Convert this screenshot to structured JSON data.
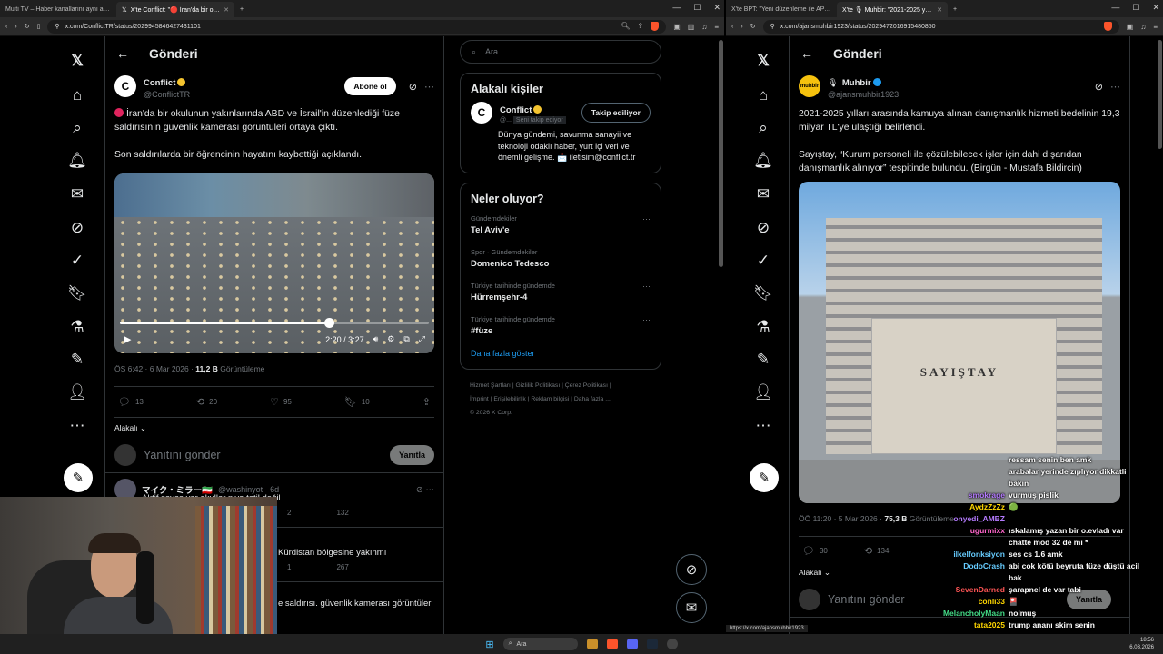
{
  "left_browser": {
    "tabs": [
      {
        "label": "Multi TV – Haber kanallarını aynı an..."
      },
      {
        "label": "X'te Conflict: \"🔴 İran'da bir oku...",
        "active": true
      }
    ],
    "url": "x.com/ConflictTR/status/2029945846427431101"
  },
  "right_browser": {
    "tabs": [
      {
        "label": "X'te BPT: \"Yeni düzenleme ile APP pl..."
      },
      {
        "label": "X'te 🎙 Muhbir: \"2021-2025 yılla...",
        "active": true
      }
    ],
    "url": "x.com/ajansmuhbir1923/status/2029472016915480850",
    "status_link": "https://x.com/ajansmuhbir1923"
  },
  "header": {
    "title": "Gönderi"
  },
  "tweet_left": {
    "name": "Conflict",
    "handle": "@ConflictTR",
    "subscribe_label": "Abone ol",
    "avatar_letter": "C",
    "para1": "İran'da bir okulunun yakınlarında ABD ve İsrail'in düzenlediği füze saldırısının güvenlik kamerası görüntüleri ortaya çıktı.",
    "para2": "Son saldırılarda bir öğrencinin hayatını kaybettiği açıklandı.",
    "video_time": "2:20 / 3:27",
    "video_progress": 0.677,
    "timestamp": "ÖS 6:42 · 6 Mar 2026 · ",
    "views": "11,2 B",
    "views_label": "Görüntüleme",
    "replies": "13",
    "retweets": "20",
    "likes": "95",
    "bookmarks": "10",
    "relevant": "Alakalı"
  },
  "reply_box": {
    "placeholder": "Yanıtını gönder",
    "button": "Yanıtla"
  },
  "comments": [
    {
      "name": "マイク・ミラー🇮🇷",
      "handle": "@washinyot · 6d",
      "text": "Aktif savaş var okullar niye tatil değil",
      "stat1": "2",
      "stat2": "132"
    },
    {
      "name": "",
      "handle": "",
      "text": "Kürdistan bölgesine yakınmı",
      "stat1": "1",
      "stat2": "267"
    },
    {
      "name": "",
      "handle": "",
      "text": "e saldırısı. güvenlik kamerası görüntüleri",
      "stat1": "",
      "stat2": ""
    }
  ],
  "sidebar": {
    "search_placeholder": "Ara",
    "related_title": "Alakalı kişiler",
    "related_user": {
      "name": "Conflict",
      "handle": "@...",
      "follows_you": "Seni takip ediyor",
      "button": "Takip ediliyor",
      "bio": "Dünya gündemi, savunma sanayii ve teknoloji odaklı haber, yurt içi veri ve önemli gelişme. 📩 iletisim@conflict.tr"
    },
    "trends_title": "Neler oluyor?",
    "trends": [
      {
        "context": "Gündemdekiler",
        "topic": "Tel Aviv'e"
      },
      {
        "context": "Spor · Gündemdekiler",
        "topic": "Domenico Tedesco"
      },
      {
        "context": "Türkiye tarihinde gündemde",
        "topic": "Hürremşehr-4"
      },
      {
        "context": "Türkiye tarihinde gündemde",
        "topic": "#füze"
      }
    ],
    "show_more": "Daha fazla göster",
    "footer_line1": "Hizmet Şartları  |  Gizlilik Politikası  |  Çerez Politikası  |",
    "footer_line2": "İmprint  |  Erişilebilirlik  |  Reklam bilgisi  |  Daha fazla ...",
    "footer_line3": "© 2026 X Corp."
  },
  "tweet_right": {
    "name": "Muhbir",
    "handle": "@ajansmuhbir1923",
    "avatar_text": "muhbir",
    "para1": "2021-2025 yılları arasında kamuya alınan danışmanlık hizmeti bedelinin 19,3 milyar TL'ye ulaştığı belirlendi.",
    "para2": "Sayıştay, “Kurum personeli ile çözülebilecek işler için dahi dışarıdan danışmanlık alınıyor” tespitinde bulundu. (Birgün - Mustafa Bildircin)",
    "image_sign": "SAYIŞTAY",
    "timestamp": "ÖÖ 11:20 · 5 Mar 2026 · ",
    "views": "75,3 B",
    "views_label": "Görüntüleme",
    "replies": "30",
    "retweets": "134",
    "relevant": "Alakalı"
  },
  "chat": [
    {
      "user": "",
      "color": "#ff4444",
      "msg": "ressam senin ben amk"
    },
    {
      "user": "",
      "color": "#ff4444",
      "msg": ""
    },
    {
      "user": "",
      "color": "#44aaff",
      "msg": "arabalar yerinde zıplıyor dikkatli"
    },
    {
      "user": "",
      "color": "#44aaff",
      "msg": "bakın"
    },
    {
      "user": "smokrage",
      "color": "#b57bff",
      "msg": "vurmuş pislik"
    },
    {
      "user": "AydzZzZz",
      "color": "#ffd700",
      "msg": "🟢"
    },
    {
      "user": "onyedi_AMBZ",
      "color": "#b57bff",
      "msg": ""
    },
    {
      "user": "ugurmixx",
      "color": "#ff66cc",
      "msg": "ıskalamış yazan bir o.evladı var"
    },
    {
      "user": "",
      "color": "#ffffff",
      "msg": "chatte mod 32 de mi *"
    },
    {
      "user": "ilkelfonksiyon",
      "color": "#66ccff",
      "msg": "ses cs 1.6 amk"
    },
    {
      "user": "DodoCrash",
      "color": "#66ccff",
      "msg": "abi cok kötü beyruta füze düştü acil"
    },
    {
      "user": "",
      "color": "#ffffff",
      "msg": "bak"
    },
    {
      "user": "SevenDarned",
      "color": "#ff5555",
      "msg": "şarapnel de var tabi"
    },
    {
      "user": "conli33",
      "color": "#ffd700",
      "msg": "🎴"
    },
    {
      "user": "MelancholyMaan",
      "color": "#44dd88",
      "msg": "nolmuş"
    },
    {
      "user": "tata2025",
      "color": "#ffd700",
      "msg": "trump ananı skim senin"
    }
  ],
  "taskbar": {
    "search": "Ara",
    "time": "18:56",
    "date": "6.03.2026"
  }
}
